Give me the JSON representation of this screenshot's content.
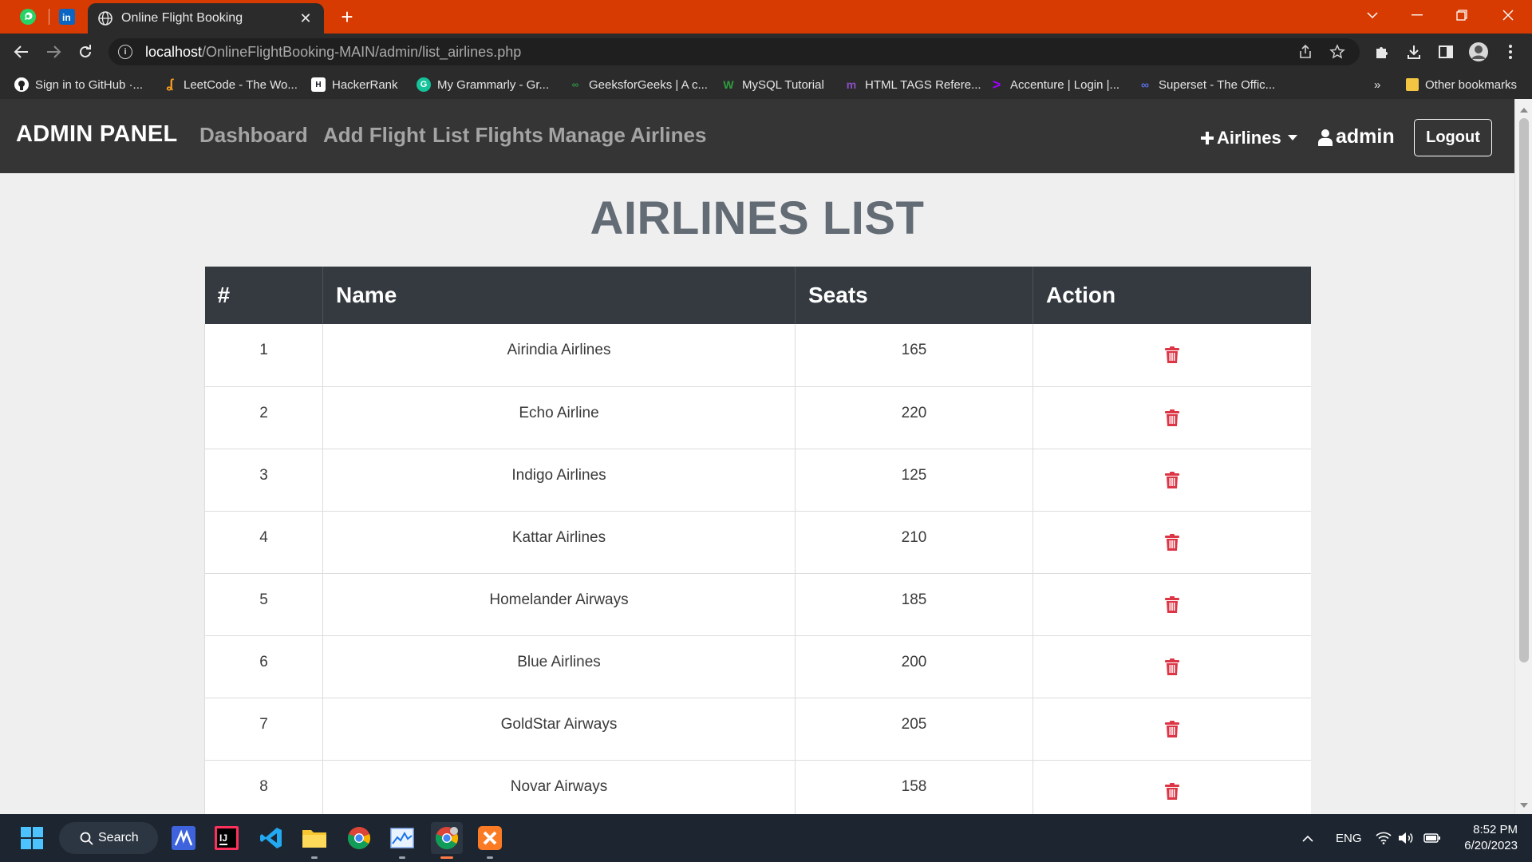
{
  "browser": {
    "tab_title": "Online Flight Booking",
    "url_host": "localhost",
    "url_path": "/OnlineFlightBooking-MAIN/admin/list_airlines.php",
    "bookmarks": [
      {
        "label": "Sign in to GitHub ·...",
        "icon": "github-icon"
      },
      {
        "label": "LeetCode - The Wo...",
        "icon": "leetcode-icon"
      },
      {
        "label": "HackerRank",
        "icon": "hackerrank-icon"
      },
      {
        "label": "My Grammarly - Gr...",
        "icon": "grammarly-icon"
      },
      {
        "label": "GeeksforGeeks | A c...",
        "icon": "geeksforgeeks-icon"
      },
      {
        "label": "MySQL Tutorial",
        "icon": "mysql-icon"
      },
      {
        "label": "HTML TAGS Refere...",
        "icon": "html-tags-icon"
      },
      {
        "label": "Accenture | Login |...",
        "icon": "accenture-icon"
      },
      {
        "label": "Superset - The Offic...",
        "icon": "superset-icon"
      }
    ],
    "more_bookmarks": "»",
    "other_bookmarks": "Other bookmarks"
  },
  "navbar": {
    "brand": "ADMIN PANEL",
    "links": [
      "Dashboard",
      "Add Flight",
      "List Flights",
      "Manage Airlines"
    ],
    "airlines_menu": "Airlines",
    "user": "admin",
    "logout": "Logout"
  },
  "page": {
    "title": "AIRLINES LIST"
  },
  "table": {
    "headers": [
      "#",
      "Name",
      "Seats",
      "Action"
    ],
    "rows": [
      {
        "num": "1",
        "name": "Airindia Airlines",
        "seats": "165"
      },
      {
        "num": "2",
        "name": "Echo Airline",
        "seats": "220"
      },
      {
        "num": "3",
        "name": "Indigo Airlines",
        "seats": "125"
      },
      {
        "num": "4",
        "name": "Kattar Airlines",
        "seats": "210"
      },
      {
        "num": "5",
        "name": "Homelander Airways",
        "seats": "185"
      },
      {
        "num": "6",
        "name": "Blue Airlines",
        "seats": "200"
      },
      {
        "num": "7",
        "name": "GoldStar Airways",
        "seats": "205"
      },
      {
        "num": "8",
        "name": "Novar Airways",
        "seats": "158"
      }
    ]
  },
  "taskbar": {
    "search_label": "Search",
    "language": "ENG",
    "time": "8:52 PM",
    "date": "6/20/2023"
  },
  "colors": {
    "tabbar": "#d83b01",
    "navbar": "#353535",
    "table_header": "#343a40",
    "delete_icon": "#dc3545",
    "title": "#636b75"
  }
}
